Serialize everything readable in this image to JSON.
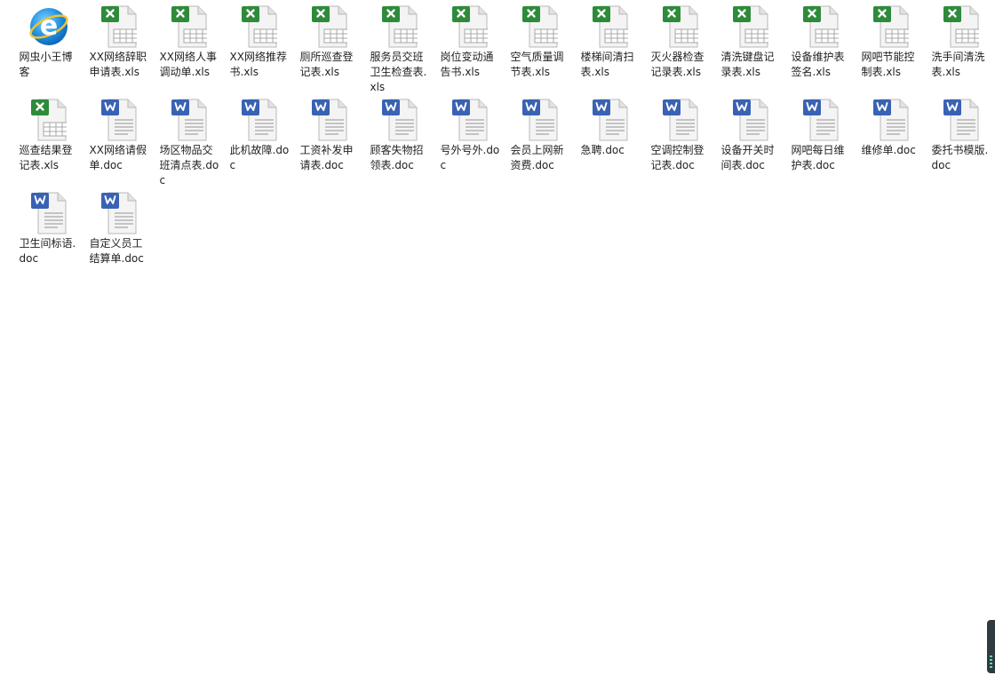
{
  "colors": {
    "excel_badge": "#2e8b3a",
    "word_badge": "#3a62b3",
    "ie_blue": "#1e8fe0",
    "page_fill": "#f4f4f4",
    "page_border": "#b9b9b9"
  },
  "files": [
    {
      "name": "网虫小王博客",
      "type": "ie",
      "icon": "internet-explorer-icon"
    },
    {
      "name": "XX网络辞职申请表.xls",
      "type": "xls",
      "icon": "excel-file-icon"
    },
    {
      "name": "XX网络人事调动单.xls",
      "type": "xls",
      "icon": "excel-file-icon"
    },
    {
      "name": "XX网络推荐书.xls",
      "type": "xls",
      "icon": "excel-file-icon"
    },
    {
      "name": "厕所巡查登记表.xls",
      "type": "xls",
      "icon": "excel-file-icon"
    },
    {
      "name": "服务员交班卫生检查表.xls",
      "type": "xls",
      "icon": "excel-file-icon"
    },
    {
      "name": "岗位变动通告书.xls",
      "type": "xls",
      "icon": "excel-file-icon"
    },
    {
      "name": "空气质量调节表.xls",
      "type": "xls",
      "icon": "excel-file-icon"
    },
    {
      "name": "楼梯间清扫表.xls",
      "type": "xls",
      "icon": "excel-file-icon"
    },
    {
      "name": "灭火器检查记录表.xls",
      "type": "xls",
      "icon": "excel-file-icon"
    },
    {
      "name": "清洗键盘记录表.xls",
      "type": "xls",
      "icon": "excel-file-icon"
    },
    {
      "name": "设备维护表签名.xls",
      "type": "xls",
      "icon": "excel-file-icon"
    },
    {
      "name": "网吧节能控制表.xls",
      "type": "xls",
      "icon": "excel-file-icon"
    },
    {
      "name": "洗手间清洗表.xls",
      "type": "xls",
      "icon": "excel-file-icon"
    },
    {
      "name": "巡查结果登记表.xls",
      "type": "xls",
      "icon": "excel-file-icon"
    },
    {
      "name": "XX网络请假单.doc",
      "type": "doc",
      "icon": "word-file-icon"
    },
    {
      "name": "场区物品交班清点表.doc",
      "type": "doc",
      "icon": "word-file-icon"
    },
    {
      "name": "此机故障.doc",
      "type": "doc",
      "icon": "word-file-icon"
    },
    {
      "name": "工资补发申请表.doc",
      "type": "doc",
      "icon": "word-file-icon"
    },
    {
      "name": "顾客失物招领表.doc",
      "type": "doc",
      "icon": "word-file-icon"
    },
    {
      "name": "号外号外.doc",
      "type": "doc",
      "icon": "word-file-icon"
    },
    {
      "name": "会员上网新资费.doc",
      "type": "doc",
      "icon": "word-file-icon"
    },
    {
      "name": "急聘.doc",
      "type": "doc",
      "icon": "word-file-icon"
    },
    {
      "name": "空调控制登记表.doc",
      "type": "doc",
      "icon": "word-file-icon"
    },
    {
      "name": "设备开关时间表.doc",
      "type": "doc",
      "icon": "word-file-icon"
    },
    {
      "name": "网吧每日维护表.doc",
      "type": "doc",
      "icon": "word-file-icon"
    },
    {
      "name": "维修单.doc",
      "type": "doc",
      "icon": "word-file-icon"
    },
    {
      "name": "委托书模版.doc",
      "type": "doc",
      "icon": "word-file-icon"
    },
    {
      "name": "卫生间标语.doc",
      "type": "doc",
      "icon": "word-file-icon"
    },
    {
      "name": "自定义员工结算单.doc",
      "type": "doc",
      "icon": "word-file-icon"
    }
  ]
}
